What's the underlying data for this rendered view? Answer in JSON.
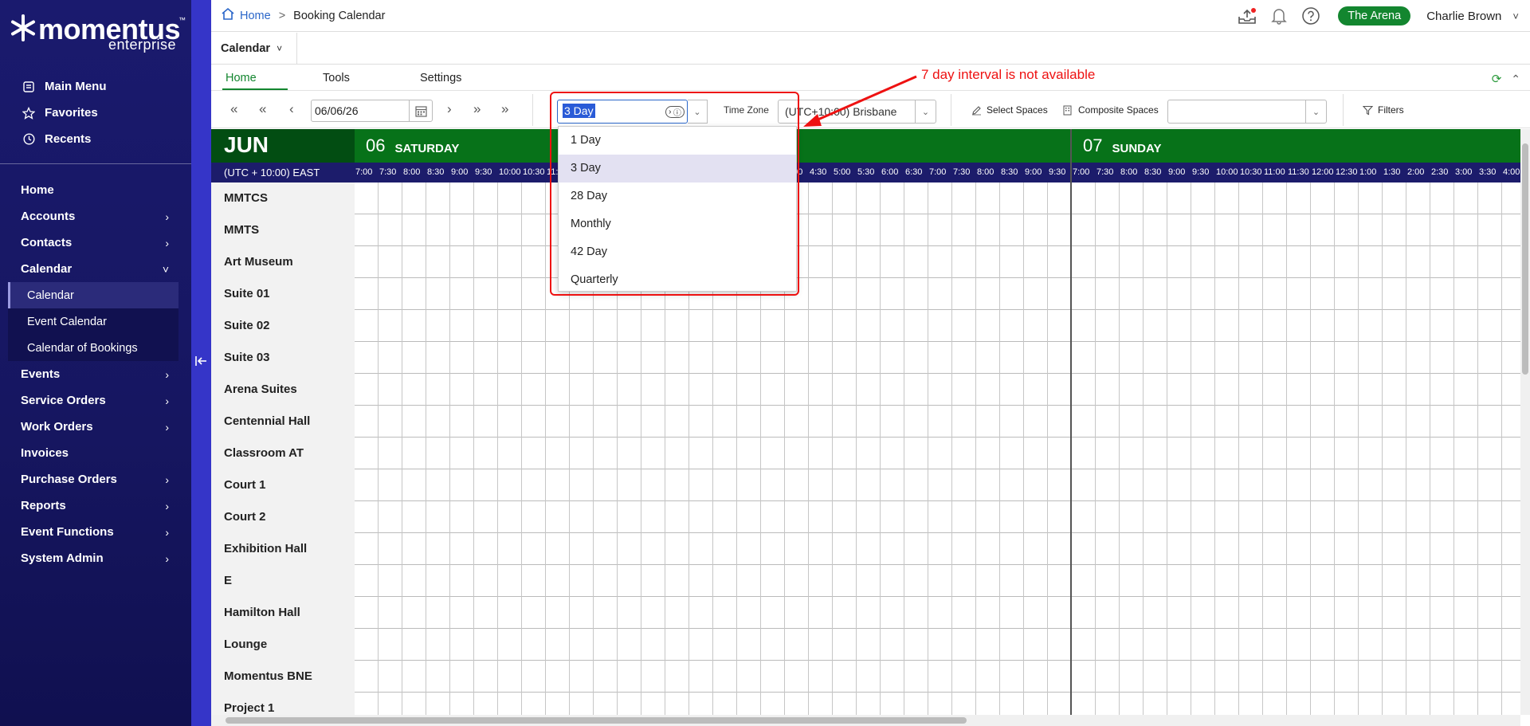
{
  "brand": {
    "name": "momentus",
    "tm": "™",
    "sub": "enterprise"
  },
  "sidebar": {
    "top_links": [
      {
        "label": "Main Menu",
        "icon": "menu-icon"
      },
      {
        "label": "Favorites",
        "icon": "star-icon"
      },
      {
        "label": "Recents",
        "icon": "clock-icon"
      }
    ],
    "nav": [
      {
        "label": "Home"
      },
      {
        "label": "Accounts",
        "chev": "›"
      },
      {
        "label": "Contacts",
        "chev": "›"
      },
      {
        "label": "Calendar",
        "chev": "˅"
      },
      {
        "label": "Events",
        "chev": "›"
      },
      {
        "label": "Service Orders",
        "chev": "›"
      },
      {
        "label": "Work Orders",
        "chev": "›"
      },
      {
        "label": "Invoices"
      },
      {
        "label": "Purchase Orders",
        "chev": "›"
      },
      {
        "label": "Reports",
        "chev": "›"
      },
      {
        "label": "Event Functions",
        "chev": "›"
      },
      {
        "label": "System Admin",
        "chev": "›"
      }
    ],
    "calendar_sub": [
      "Calendar",
      "Event Calendar",
      "Calendar of Bookings"
    ]
  },
  "header": {
    "breadcrumb_home": "Home",
    "breadcrumb_sep": ">",
    "breadcrumb_current": "Booking Calendar",
    "venue": "The Arena",
    "user": "Charlie Brown"
  },
  "module": {
    "label": "Calendar"
  },
  "tabs": {
    "home": "Home",
    "tools": "Tools",
    "settings": "Settings"
  },
  "toolbar": {
    "nav_buttons": [
      "«",
      "«",
      "‹",
      "›",
      "»",
      "»"
    ],
    "date": "06/06/26",
    "interval_value": "3 Day",
    "timezone_label": "Time Zone",
    "timezone_value": "(UTC+10:00) Brisbane",
    "select_spaces": "Select Spaces",
    "composite_spaces": "Composite Spaces",
    "filters": "Filters"
  },
  "dropdown": {
    "options": [
      "1 Day",
      "3 Day",
      "28 Day",
      "Monthly",
      "42 Day",
      "Quarterly"
    ],
    "selected": "3 Day"
  },
  "annotation": "7 day interval is not available",
  "calendar": {
    "month": "JUN",
    "timezone": "(UTC + 10:00) EAST",
    "days": [
      {
        "num": "06",
        "name": "SATURDAY"
      },
      {
        "num": "07",
        "name": "SUNDAY"
      }
    ],
    "hours_day1": [
      "7:00",
      "7:30",
      "8:00",
      "8:30",
      "9:00",
      "9:30",
      "10:00",
      "10:30",
      "11:00",
      "11:30",
      "12:00",
      "12:30",
      "1:00",
      "1:30",
      "2:00",
      "2:30",
      "3:00",
      "3:30",
      "4:00",
      "4:30",
      "5:00",
      "5:30",
      "6:00",
      "6:30",
      "7:00",
      "7:30",
      "8:00",
      "8:30",
      "9:00",
      "9:30"
    ],
    "hours_day2": [
      "7:00",
      "7:30",
      "8:00",
      "8:30",
      "9:00",
      "9:30",
      "10:00",
      "10:30",
      "11:00",
      "11:30",
      "12:00",
      "12:30",
      "1:00",
      "1:30",
      "2:00",
      "2:30",
      "3:00",
      "3:30",
      "4:00"
    ],
    "spaces": [
      "MMTCS",
      "MMTS",
      "Art Museum",
      "Suite 01",
      "Suite 02",
      "Suite 03",
      "Arena Suites",
      "Centennial Hall",
      "Classroom AT",
      "Court 1",
      "Court 2",
      "Exhibition Hall",
      "E",
      "Hamilton Hall",
      "Lounge",
      "Momentus BNE",
      "Project 1"
    ]
  }
}
